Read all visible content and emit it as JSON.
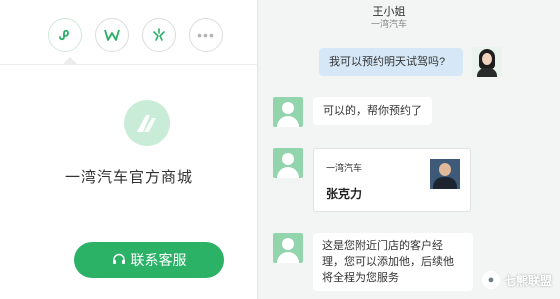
{
  "left_panel": {
    "icons": [
      {
        "name": "mini-program-icon",
        "glyph": "𝓈"
      },
      {
        "name": "brand-icon",
        "glyph": "Ⓦ"
      },
      {
        "name": "sparkle-icon",
        "glyph": "⚹"
      },
      {
        "name": "more-icon",
        "glyph": "•••"
      }
    ],
    "store_name": "一湾汽车官方商城",
    "service_button": "联系客服",
    "accent_color": "#2bb267"
  },
  "chat": {
    "contact_name": "王小姐",
    "contact_company": "一湾汽车",
    "messages": [
      {
        "from": "me",
        "text": "我可以预约明天试驾吗?"
      },
      {
        "from": "other",
        "text": "可以的，帮你预约了"
      },
      {
        "from": "other",
        "type": "card",
        "company": "一湾汽车",
        "name": "张克力"
      },
      {
        "from": "other",
        "text": "这是您附近门店的客户经理，您可以添加他，后续他将全程为您服务"
      }
    ]
  },
  "watermark": {
    "text": "七熊联盟"
  }
}
